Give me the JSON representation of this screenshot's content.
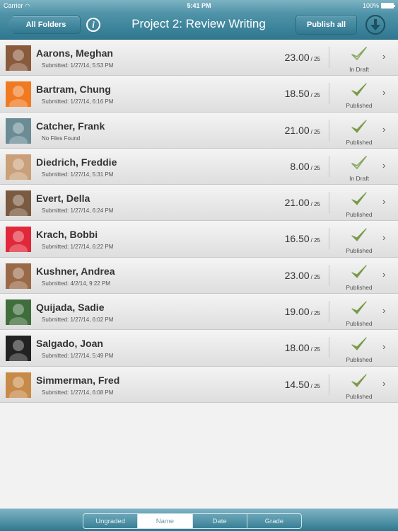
{
  "status_bar": {
    "carrier": "Carrier",
    "time": "5:41 PM",
    "battery": "100%"
  },
  "header": {
    "back_label": "All Folders",
    "title": "Project 2: Review Writing",
    "publish_all_label": "Publish all",
    "info_icon": "info-icon",
    "download_icon": "download-icon"
  },
  "students": [
    {
      "name": "Aarons, Meghan",
      "submitted": "Submitted: 1/27/14, 5:53 PM",
      "score": "23.00",
      "out_of": "/ 25",
      "status": "In Draft",
      "avatar_color": "#8a5a3c"
    },
    {
      "name": "Bartram, Chung",
      "submitted": "Submitted: 1/27/14, 6:16 PM",
      "score": "18.50",
      "out_of": "/ 25",
      "status": "Published",
      "avatar_color": "#f07a22"
    },
    {
      "name": "Catcher, Frank",
      "submitted": "No Files Found",
      "score": "21.00",
      "out_of": "/ 25",
      "status": "Published",
      "avatar_color": "#6b8b95"
    },
    {
      "name": "Diedrich, Freddie",
      "submitted": "Submitted: 1/27/14, 5:31 PM",
      "score": "8.00",
      "out_of": "/ 25",
      "status": "In Draft",
      "avatar_color": "#c9a07a"
    },
    {
      "name": "Evert, Della",
      "submitted": "Submitted: 1/27/14, 6:24 PM",
      "score": "21.00",
      "out_of": "/ 25",
      "status": "Published",
      "avatar_color": "#7a5a40"
    },
    {
      "name": "Krach, Bobbi",
      "submitted": "Submitted: 1/27/14, 6:22 PM",
      "score": "16.50",
      "out_of": "/ 25",
      "status": "Published",
      "avatar_color": "#e0283a"
    },
    {
      "name": "Kushner, Andrea",
      "submitted": "Submitted: 4/2/14, 9:22 PM",
      "score": "23.00",
      "out_of": "/ 25",
      "status": "Published",
      "avatar_color": "#9a6a48"
    },
    {
      "name": "Quijada, Sadie",
      "submitted": "Submitted: 1/27/14, 6:02 PM",
      "score": "19.00",
      "out_of": "/ 25",
      "status": "Published",
      "avatar_color": "#3f6e3c"
    },
    {
      "name": "Salgado, Joan",
      "submitted": "Submitted: 1/27/14, 5:49 PM",
      "score": "18.00",
      "out_of": "/ 25",
      "status": "Published",
      "avatar_color": "#222222"
    },
    {
      "name": "Simmerman, Fred",
      "submitted": "Submitted: 1/27/14, 6:08 PM",
      "score": "14.50",
      "out_of": "/ 25",
      "status": "Published",
      "avatar_color": "#c88a48"
    }
  ],
  "sort_tabs": [
    {
      "label": "Ungraded",
      "active": false
    },
    {
      "label": "Name",
      "active": true
    },
    {
      "label": "Date",
      "active": false
    },
    {
      "label": "Grade",
      "active": false
    }
  ],
  "colors": {
    "accent": "#2f7890",
    "check_published": "#7a9a4a",
    "check_draft": "#8aa860"
  }
}
